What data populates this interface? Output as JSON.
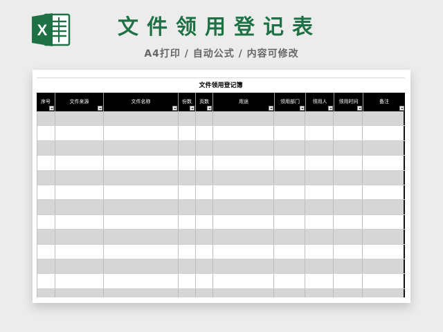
{
  "header": {
    "title": "文件领用登记表",
    "subtitle": "A4打印 / 自动公式 / 内容可修改",
    "logo_letter": "X",
    "logo_icon": "excel-logo-icon",
    "brand_color": "#1e7145"
  },
  "sheet": {
    "title": "文件领用登记簿",
    "columns": [
      {
        "label": "序号"
      },
      {
        "label": "文件来源"
      },
      {
        "label": "文件名称"
      },
      {
        "label": "份数"
      },
      {
        "label": "页数"
      },
      {
        "label": "用途"
      },
      {
        "label": "领用部门"
      },
      {
        "label": "领用人"
      },
      {
        "label": "领用时间"
      },
      {
        "label": "备注"
      }
    ],
    "filter_icon": "filter-dropdown-icon"
  }
}
